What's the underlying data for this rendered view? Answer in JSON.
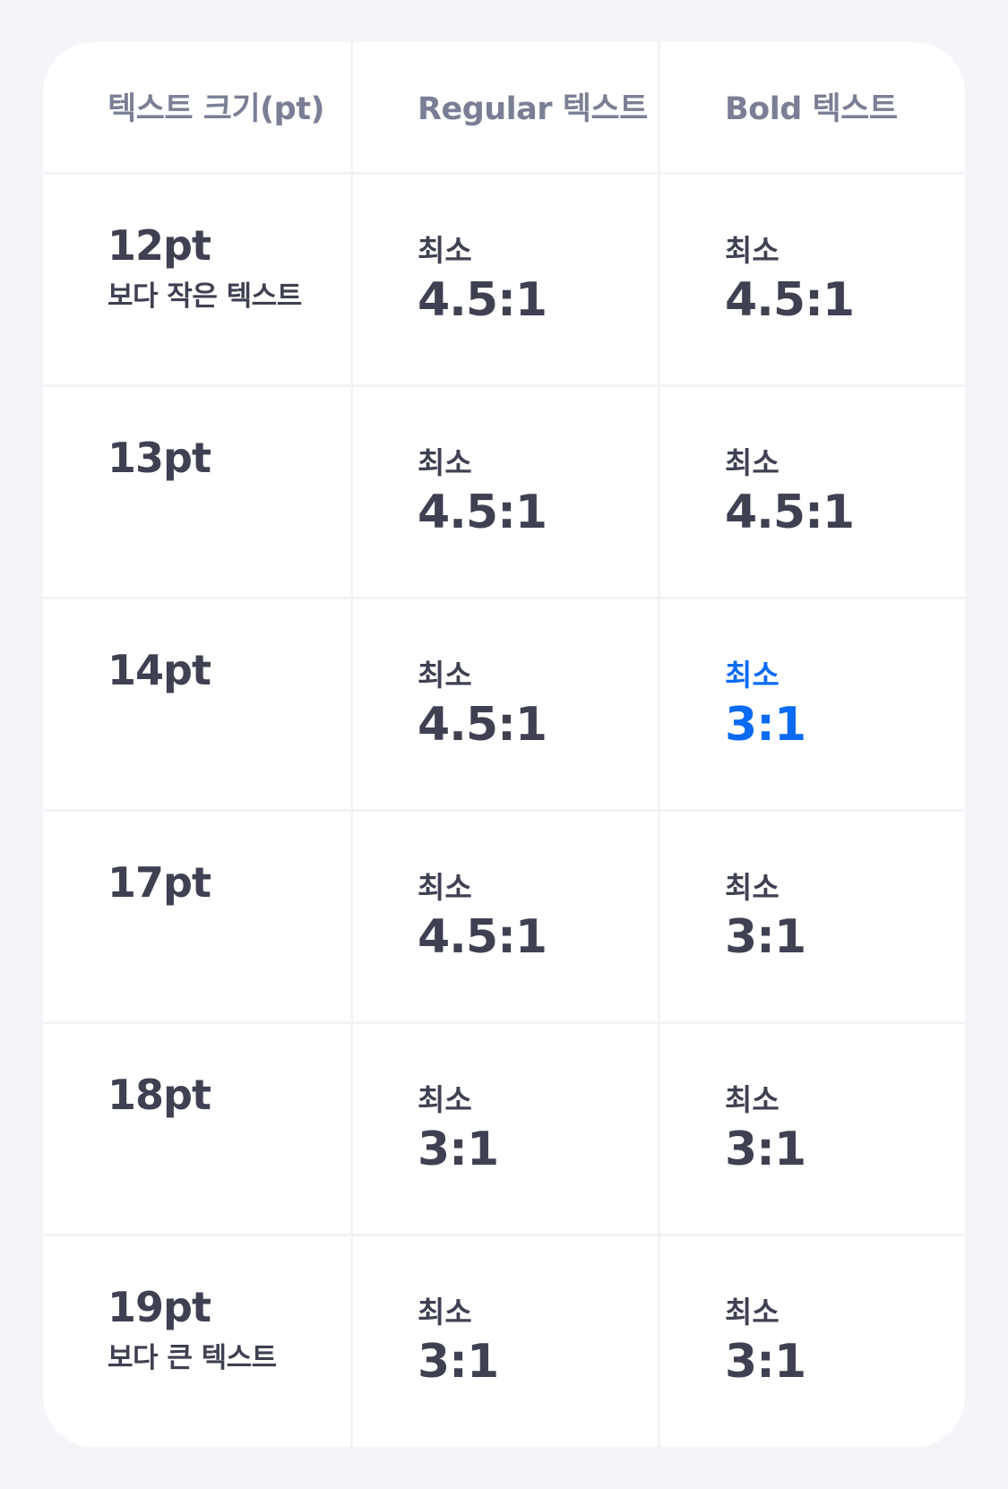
{
  "header": {
    "col1": "텍스트 크기(pt)",
    "col2": "Regular 텍스트",
    "col3": "Bold 텍스트"
  },
  "rows": [
    {
      "size": "12pt",
      "note": "보다 작은 텍스트",
      "regular": {
        "label": "최소",
        "ratio": "4.5:1"
      },
      "bold": {
        "label": "최소",
        "ratio": "4.5:1"
      }
    },
    {
      "size": "13pt",
      "note": "",
      "regular": {
        "label": "최소",
        "ratio": "4.5:1"
      },
      "bold": {
        "label": "최소",
        "ratio": "4.5:1"
      }
    },
    {
      "size": "14pt",
      "note": "",
      "regular": {
        "label": "최소",
        "ratio": "4.5:1"
      },
      "bold": {
        "label": "최소",
        "ratio": "3:1"
      }
    },
    {
      "size": "17pt",
      "note": "",
      "regular": {
        "label": "최소",
        "ratio": "4.5:1"
      },
      "bold": {
        "label": "최소",
        "ratio": "3:1"
      }
    },
    {
      "size": "18pt",
      "note": "",
      "regular": {
        "label": "최소",
        "ratio": "3:1"
      },
      "bold": {
        "label": "최소",
        "ratio": "3:1"
      }
    },
    {
      "size": "19pt",
      "note": "보다 큰 텍스트",
      "regular": {
        "label": "최소",
        "ratio": "3:1"
      },
      "bold": {
        "label": "최소",
        "ratio": "3:1"
      }
    }
  ],
  "colors": {
    "background": "#f4f5f9",
    "card": "#ffffff",
    "text": "#3f4152",
    "header_text": "#7b7f95",
    "highlight": "#0b6bf5"
  }
}
